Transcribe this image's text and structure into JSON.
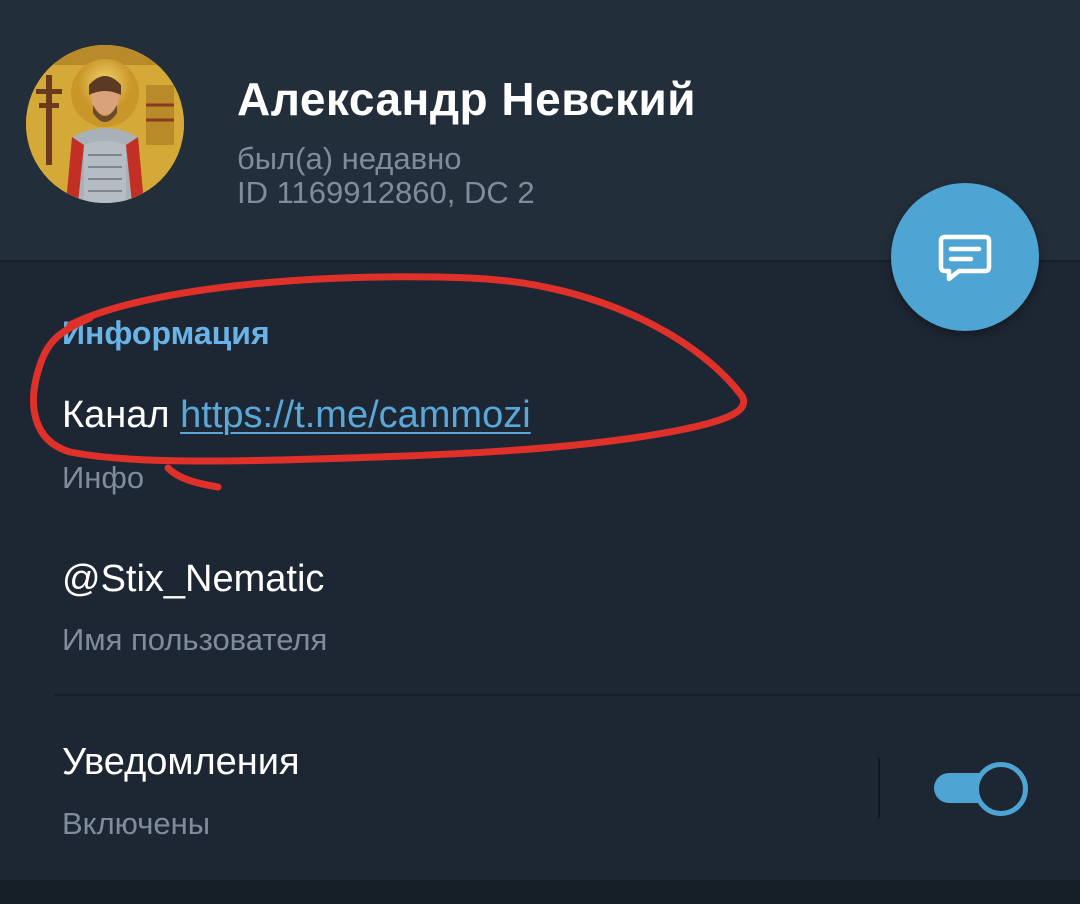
{
  "profile": {
    "name": "Александр Невский",
    "status": "был(а) недавно",
    "id_line": "ID 1169912860, DC 2",
    "avatar_icon": "saint-icon-avatar"
  },
  "fab": {
    "icon": "message-icon",
    "color": "#4ea4d2"
  },
  "info_section": {
    "title": "Информация",
    "bio_prefix": "Канал ",
    "bio_link": "https://t.me/cammozi",
    "bio_label": "Инфо",
    "username": "@Stix_Nematic",
    "username_label": "Имя пользователя"
  },
  "notifications": {
    "title": "Уведомления",
    "status": "Включены",
    "enabled": true
  },
  "colors": {
    "background": "#1d2733",
    "header": "#222e3a",
    "accent": "#4ea4d2",
    "section_title": "#6ab3e8",
    "annotation": "#e0302a"
  }
}
